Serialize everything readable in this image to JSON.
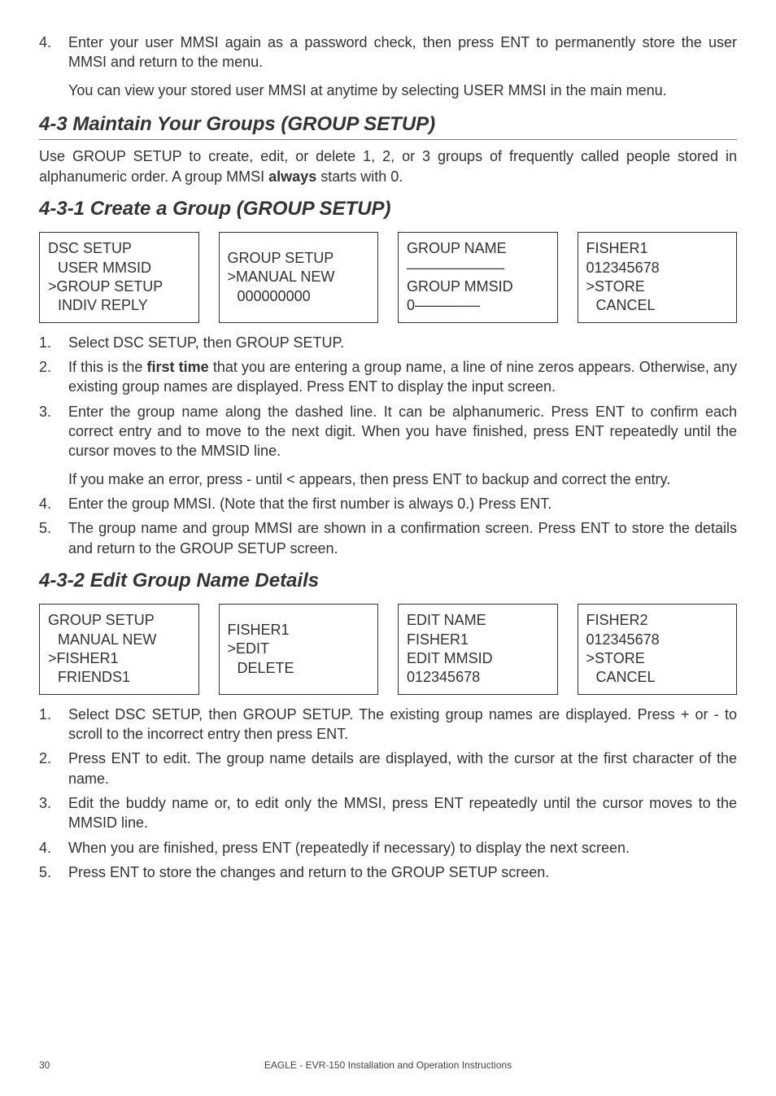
{
  "top": {
    "step4": {
      "num": "4.",
      "p1": "Enter your user MMSI again as a password check, then press ENT to permanently store the user MMSI and return to the menu.",
      "p2": "You can view your stored user MMSI at anytime by selecting USER MMSI in the main menu."
    }
  },
  "sec43": {
    "title": "4-3 Maintain Your Groups (GROUP SETUP)",
    "intro_a": "Use GROUP SETUP to create, edit, or delete 1, 2, or 3 groups of frequently called people stored in alphanumeric order. A group MMSI ",
    "intro_bold": "always",
    "intro_b": " starts with 0."
  },
  "sec431": {
    "title": "4-3-1 Create a Group (GROUP SETUP)",
    "screens": {
      "a": {
        "l1": "DSC SETUP",
        "l2": "USER MMSID",
        "l3": ">GROUP SETUP",
        "l4": "INDIV REPLY"
      },
      "b": {
        "l1": "GROUP SETUP",
        "l2": ">MANUAL NEW",
        "l3": "000000000"
      },
      "c": {
        "l1": "GROUP NAME",
        "l2": "––––––––––––",
        "l3": "GROUP MMSID",
        "l4": "0––––––––"
      },
      "d": {
        "l1": "FISHER1",
        "l2": "012345678",
        "l3": ">STORE",
        "l4": "CANCEL"
      }
    },
    "steps": {
      "s1": {
        "num": "1.",
        "text": "Select DSC SETUP, then GROUP SETUP."
      },
      "s2": {
        "num": "2.",
        "pre": "If this is the ",
        "bold": "first time",
        "post": " that you are entering a group name, a line of nine zeros appears. Otherwise, any existing group names are displayed. Press ENT to display the input screen."
      },
      "s3": {
        "num": "3.",
        "p1": "Enter the group name along the dashed line. It can be alphanumeric. Press ENT to confirm each correct entry and to move to the next digit. When you have finished, press ENT repeatedly until the cursor moves to the MMSID line.",
        "p2": "If you make an error, press - until < appears, then press ENT to backup and correct the entry."
      },
      "s4": {
        "num": "4.",
        "text": "Enter the group MMSI. (Note that the first number is always 0.) Press ENT."
      },
      "s5": {
        "num": "5.",
        "text": "The group name and group MMSI are shown in a confirmation screen. Press ENT to store the details and return to the GROUP SETUP screen."
      }
    }
  },
  "sec432": {
    "title": "4-3-2 Edit Group Name Details",
    "screens": {
      "a": {
        "l1": "GROUP SETUP",
        "l2": "MANUAL NEW",
        "l3": ">FISHER1",
        "l4": "FRIENDS1"
      },
      "b": {
        "l1": "FISHER1",
        "l2": ">EDIT",
        "l3": "DELETE"
      },
      "c": {
        "l1": "EDIT NAME",
        "l2": "FISHER1",
        "l3": "EDIT MMSID",
        "l4": "012345678"
      },
      "d": {
        "l1": "FISHER2",
        "l2": "012345678",
        "l3": ">STORE",
        "l4": "CANCEL"
      }
    },
    "steps": {
      "s1": {
        "num": "1.",
        "text": "Select DSC SETUP, then GROUP SETUP. The existing group names are displayed. Press + or - to scroll to the incorrect entry then press ENT."
      },
      "s2": {
        "num": "2.",
        "text": "Press ENT to edit. The group name details are displayed, with the cursor at the first character of the name."
      },
      "s3": {
        "num": "3.",
        "text": "Edit the buddy name or, to edit only the MMSI, press ENT repeatedly until the cursor moves to the MMSID line."
      },
      "s4": {
        "num": "4.",
        "text": "When you are finished, press ENT (repeatedly if necessary) to display the next screen."
      },
      "s5": {
        "num": "5.",
        "text": "Press ENT to store the changes and return to the GROUP SETUP screen."
      }
    }
  },
  "footer": {
    "page": "30",
    "text": "EAGLE - EVR-150 Installation and Operation Instructions"
  }
}
